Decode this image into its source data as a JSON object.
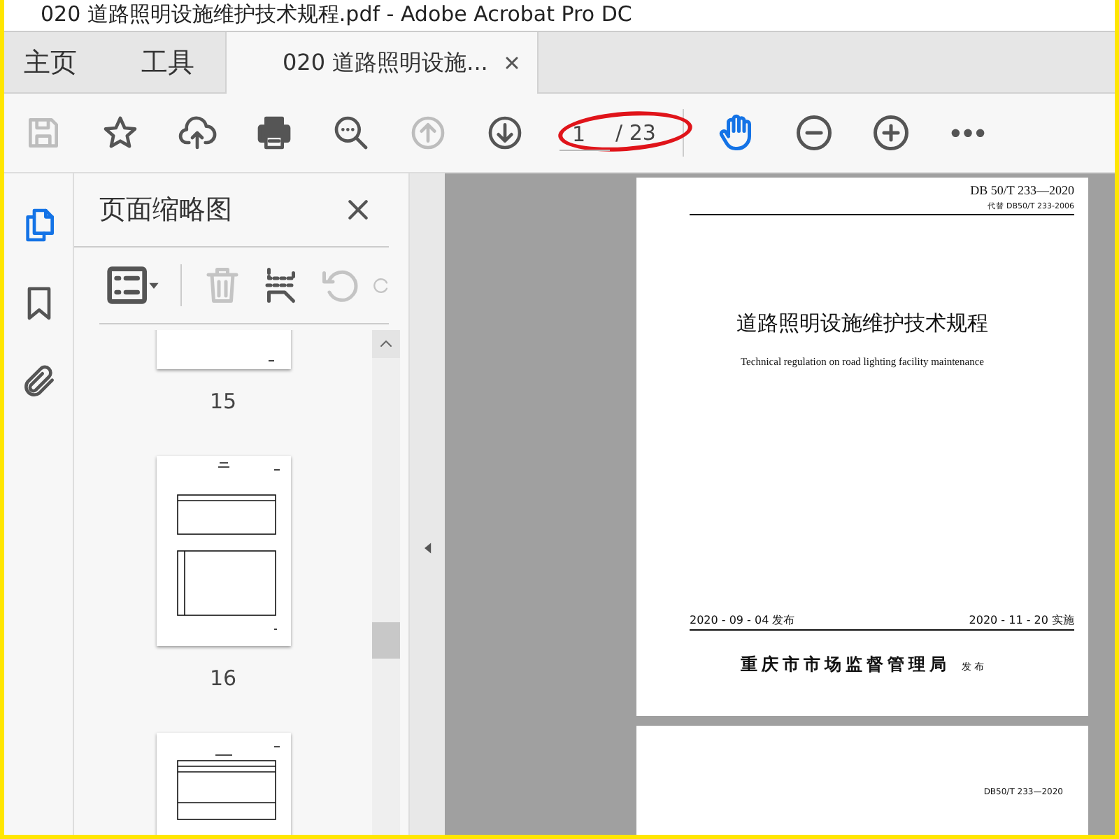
{
  "window": {
    "title": "020 道路照明设施维护技术规程.pdf - Adobe Acrobat Pro DC"
  },
  "tabs": [
    {
      "label": "主页",
      "kind": "nav",
      "selected": false
    },
    {
      "label": "工具",
      "kind": "nav",
      "selected": false
    },
    {
      "label": "020 道路照明设施...",
      "kind": "document",
      "selected": true
    }
  ],
  "toolbar": {
    "buttons": [
      {
        "kind": "save",
        "disabled": true
      },
      {
        "kind": "star",
        "disabled": false
      },
      {
        "kind": "upload",
        "disabled": false
      },
      {
        "kind": "print",
        "disabled": false
      },
      {
        "kind": "find",
        "disabled": false
      },
      {
        "kind": "prev",
        "disabled": true
      },
      {
        "kind": "next",
        "disabled": false
      }
    ],
    "page_field": {
      "value": "1",
      "total": "/ 23"
    },
    "tools": [
      {
        "kind": "hand",
        "selected": true
      },
      {
        "kind": "zoom-out",
        "selected": false
      },
      {
        "kind": "zoom-in",
        "selected": false
      },
      {
        "kind": "more",
        "selected": false
      }
    ]
  },
  "side_rail": [
    {
      "kind": "pages",
      "selected": true
    },
    {
      "kind": "bookmark",
      "selected": false
    },
    {
      "kind": "attachment",
      "selected": false
    }
  ],
  "thumbnail_panel": {
    "title": "页面缩略图",
    "tools": [
      {
        "kind": "options",
        "disabled": false
      },
      {
        "kind": "delete",
        "disabled": true
      },
      {
        "kind": "extract",
        "disabled": false
      },
      {
        "kind": "rotate",
        "disabled": true
      }
    ],
    "thumbnails": [
      {
        "label": "15"
      },
      {
        "label": "16"
      }
    ]
  },
  "document": {
    "pages": [
      {
        "kind": "cover",
        "code": "DB 50/T 233—2020",
        "replaces": "代替 DB50/T 233-2006",
        "title": "道路照明设施维护技术规程",
        "subtitle": "Technical regulation on road lighting facility maintenance",
        "issued": "2020 - 09 - 04 发布",
        "effective": "2020 - 11 - 20 实施",
        "publisher": "重庆市市场监督管理局",
        "publisher_suffix": "发 布"
      },
      {
        "kind": "plain",
        "code": "DB50/T 233—2020"
      }
    ]
  }
}
